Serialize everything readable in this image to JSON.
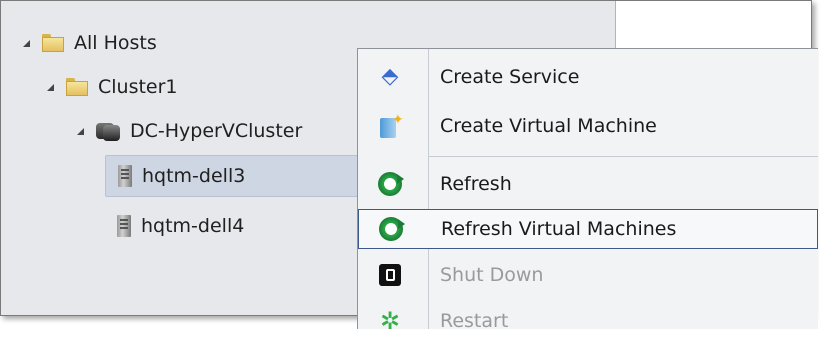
{
  "tree": {
    "all_hosts": "All Hosts",
    "cluster1": "Cluster1",
    "hyperv_cluster": "DC-HyperVCluster",
    "host1": "hqtm-dell3",
    "host2": "hqtm-dell4"
  },
  "context_menu": {
    "items": [
      {
        "label": "Create Service",
        "icon": "create-service-icon",
        "enabled": true
      },
      {
        "label": "Create Virtual Machine",
        "icon": "create-vm-icon",
        "enabled": true
      },
      {
        "label": "Refresh",
        "icon": "refresh-icon",
        "enabled": true
      },
      {
        "label": "Refresh Virtual Machines",
        "icon": "refresh-icon",
        "enabled": true,
        "highlighted": true
      },
      {
        "label": "Shut Down",
        "icon": "power-icon",
        "enabled": false
      },
      {
        "label": "Restart",
        "icon": "restart-icon",
        "enabled": false
      }
    ]
  },
  "colors": {
    "tree_bg": "#e6e8ec",
    "selection_bg": "#cfd6e3",
    "menu_bg": "#f2f3f5",
    "highlight_border": "#3b5a8a",
    "disabled_text": "#9a9a9a"
  }
}
